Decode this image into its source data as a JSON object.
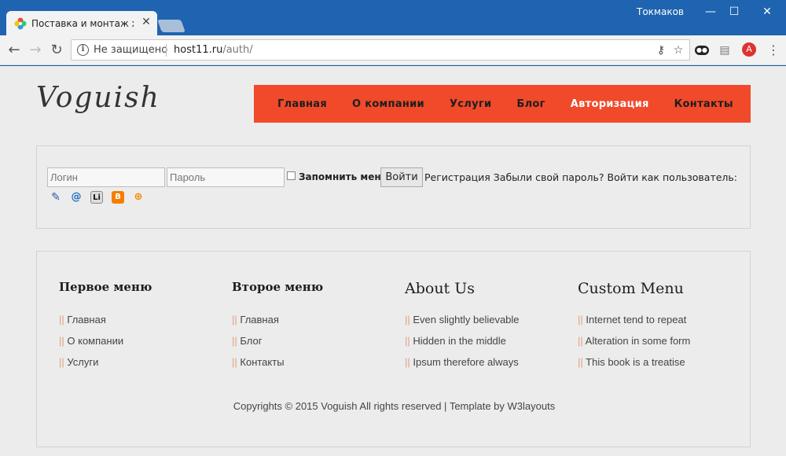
{
  "browser": {
    "tab_title": "Поставка и монтаж холо",
    "window_user": "Токмаков",
    "security_label": "Не защищено",
    "url_host": "host11.ru",
    "url_path": "/auth/"
  },
  "site": {
    "logo": "Voguish",
    "menu": [
      {
        "label": "Главная",
        "active": false
      },
      {
        "label": "О компании",
        "active": false
      },
      {
        "label": "Услуги",
        "active": false
      },
      {
        "label": "Блог",
        "active": false
      },
      {
        "label": "Авторизация",
        "active": true
      },
      {
        "label": "Контакты",
        "active": false
      }
    ],
    "menu_active_color": "#ffffff",
    "menu_bg_color": "#f04a2b"
  },
  "auth": {
    "login_placeholder": "Логин",
    "password_placeholder": "Пароль",
    "remember_label": "Запомнить меня",
    "submit_label": "Войти",
    "links_text": "Регистрация Забыли свой пароль? Войти как пользователь:",
    "social_icons": [
      "livejournal-icon",
      "mailru-icon",
      "liveinternet-icon",
      "blogger-icon",
      "openid-icon"
    ]
  },
  "footer": {
    "columns": [
      {
        "title": "Первое меню",
        "links": [
          "Главная",
          "О компании",
          "Услуги"
        ]
      },
      {
        "title": "Второе меню",
        "links": [
          "Главная",
          "Блог",
          "Контакты"
        ]
      },
      {
        "title": "About Us",
        "links": [
          "Even slightly believable",
          "Hidden in the middle",
          "Ipsum therefore always"
        ]
      },
      {
        "title": "Custom Menu",
        "links": [
          "Internet tend to repeat",
          "Alteration in some form",
          "This book is a treatise"
        ]
      }
    ],
    "link_prefix": "||",
    "copyright": "Copyrights © 2015 Voguish All rights reserved | Template by W3layouts"
  }
}
